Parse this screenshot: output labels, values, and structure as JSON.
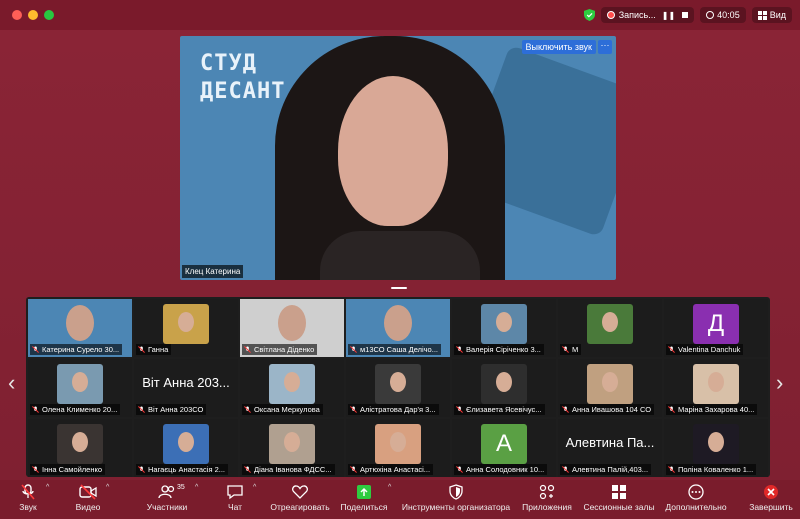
{
  "titlebar": {
    "recording_label": "Запись...",
    "pause_icon": "pause-icon",
    "stop_icon": "stop-icon",
    "timer": "40:05",
    "view_label": "Вид"
  },
  "speaker": {
    "logo_line1": "СТУД",
    "logo_line2": "ДЕСАНТ",
    "mute_button": "Выключить звук",
    "more_button": "···",
    "name": "Клец Катерина"
  },
  "gallery": {
    "tiles": [
      {
        "name": "Катерина Сурело 30...",
        "kind": "video",
        "color": "#4c86b4"
      },
      {
        "name": "Ганна",
        "kind": "photo",
        "color": "#c9a24a"
      },
      {
        "name": "Світлана Діденко",
        "kind": "video",
        "color": "#cfcfcf"
      },
      {
        "name": "м13СО Саша Делічо...",
        "kind": "video",
        "color": "#4c86b4"
      },
      {
        "name": "Валерія Сірічeнко 3...",
        "kind": "photo",
        "color": "#5d87a8"
      },
      {
        "name": "М",
        "kind": "photo",
        "color": "#4a7a3a"
      },
      {
        "name": "Valentina Danchuk",
        "kind": "letter",
        "letter": "Д",
        "color": "#8a2fb0"
      },
      {
        "name": "Олена Клименко 20...",
        "kind": "photo",
        "color": "#7a9ab0"
      },
      {
        "name": "Віт Анна 203СО",
        "kind": "text",
        "display": "Віт Анна 203..."
      },
      {
        "name": "Оксана Меркулова",
        "kind": "photo",
        "color": "#9bb5c8"
      },
      {
        "name": "Алістратова Дар'я 3...",
        "kind": "photo",
        "color": "#3a3a3a"
      },
      {
        "name": "Єлизавета Ясевічус...",
        "kind": "photo",
        "color": "#2e2e2e"
      },
      {
        "name": "Анна Ивашова 104 СО",
        "kind": "photo",
        "color": "#c0a080"
      },
      {
        "name": "Марiна Захарова 40...",
        "kind": "photo",
        "color": "#d8c0a8"
      },
      {
        "name": "Інна Самойленко",
        "kind": "photo",
        "color": "#3a3432"
      },
      {
        "name": "Нагаєць Анастасія 2...",
        "kind": "photo",
        "color": "#3c6fb6"
      },
      {
        "name": "Діана Іванова ФДСС...",
        "kind": "photo",
        "color": "#b0a090"
      },
      {
        "name": "Артюхіна Анастасі...",
        "kind": "photo",
        "color": "#d8a080"
      },
      {
        "name": "Анна Солодовник 10...",
        "kind": "letter",
        "letter": "А",
        "color": "#5aa044"
      },
      {
        "name": "Алевтина Палій,403...",
        "kind": "text",
        "display": "Алевтина Па..."
      },
      {
        "name": "Поліна Коваленко 1...",
        "kind": "photo",
        "color": "#1e1a24"
      }
    ]
  },
  "toolbar": {
    "audio": "Звук",
    "video": "Видео",
    "participants": "Участники",
    "participants_count": "35",
    "chat": "Чат",
    "react": "Отреагировать",
    "share": "Поделиться",
    "host_tools": "Инструменты организатора",
    "apps": "Приложения",
    "breakout": "Сессионные залы",
    "more": "Дополнительно",
    "end": "Завершить"
  }
}
